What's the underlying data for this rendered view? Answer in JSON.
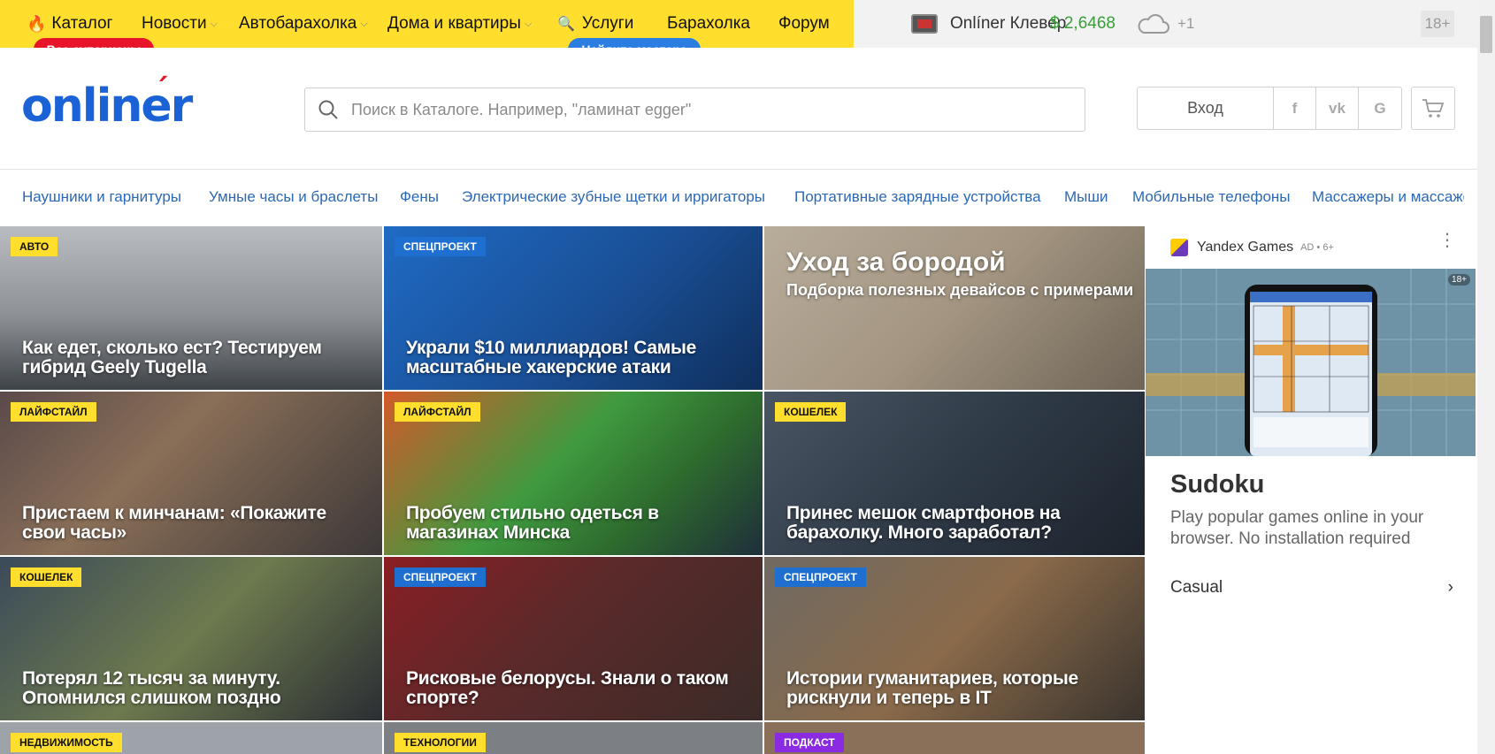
{
  "topnav": {
    "items": [
      "Каталог",
      "Новости",
      "Автобарахолка",
      "Дома и квартиры",
      "Услуги",
      "Барахолка",
      "Форум"
    ],
    "catalog_pill": "Все суперцены",
    "services_pill": "Найдите мастера"
  },
  "clever": "Onlíner Клевер",
  "currency": "$ 2,6468",
  "weather": "+1",
  "age": "18+",
  "logo": "onliner",
  "search": {
    "placeholder": "Поиск в Каталоге. Например, \"ламинат egger\""
  },
  "auth": {
    "login": "Вход",
    "fb": "f",
    "vk": "vk",
    "g": "G"
  },
  "categories": [
    "Наушники и гарнитуры",
    "Умные часы и браслеты",
    "Фены",
    "Электрические зубные щетки и ирригаторы",
    "Портативные зарядные устройства",
    "Мыши",
    "Мобильные телефоны",
    "Массажеры и массаже"
  ],
  "news": [
    {
      "tag": "АВТО",
      "title": "Как едет, сколько ест? Тестируем гибрид Geely Tugella",
      "tag_color": "yellow"
    },
    {
      "tag": "СПЕЦПРОЕКТ",
      "title": "Украли $10 миллиардов! Самые масштабные хакерские атаки",
      "tag_color": "blue"
    },
    {
      "tag": "",
      "title": "Уход за бородой",
      "subtitle": "Подборка полезных девайсов с примерами"
    },
    {
      "tag": "ЛАЙФСТАЙЛ",
      "title": "Пристаем к минчанам: «Покажите свои часы»",
      "tag_color": "yellow"
    },
    {
      "tag": "ЛАЙФСТАЙЛ",
      "title": "Пробуем стильно одеться в магазинах Минска",
      "tag_color": "yellow"
    },
    {
      "tag": "КОШЕЛЕК",
      "title": "Принес мешок смартфонов на барахолку. Много заработал?",
      "tag_color": "yellow"
    },
    {
      "tag": "КОШЕЛЕК",
      "title": "Потерял 12 тысяч за минуту. Опомнился слишком поздно",
      "tag_color": "yellow"
    },
    {
      "tag": "СПЕЦПРОЕКТ",
      "title": "Рисковые белорусы. Знали о таком спорте?",
      "tag_color": "blue"
    },
    {
      "tag": "СПЕЦПРОЕКТ",
      "title": "Истории гуманитариев, которые рискнули и теперь в IT",
      "tag_color": "blue"
    },
    {
      "tag": "НЕДВИЖИМОСТЬ",
      "title": "",
      "tag_color": "yellow"
    },
    {
      "tag": "ТЕХНОЛОГИИ",
      "title": "",
      "tag_color": "yellow"
    },
    {
      "tag": "ПОДКАСТ",
      "title": "",
      "tag_color": "purple"
    }
  ],
  "ad": {
    "brand": "Yandex Games",
    "mark": "AD • 6+",
    "badge": "18+",
    "title": "Sudoku",
    "description": "Play popular games online in your browser. No installation required",
    "category": "Casual"
  },
  "colors": {
    "accent_yellow": "#ffde2e",
    "link_blue": "#2b68b5",
    "logo_blue": "#1a62d6",
    "pill_red": "#e8152a"
  }
}
